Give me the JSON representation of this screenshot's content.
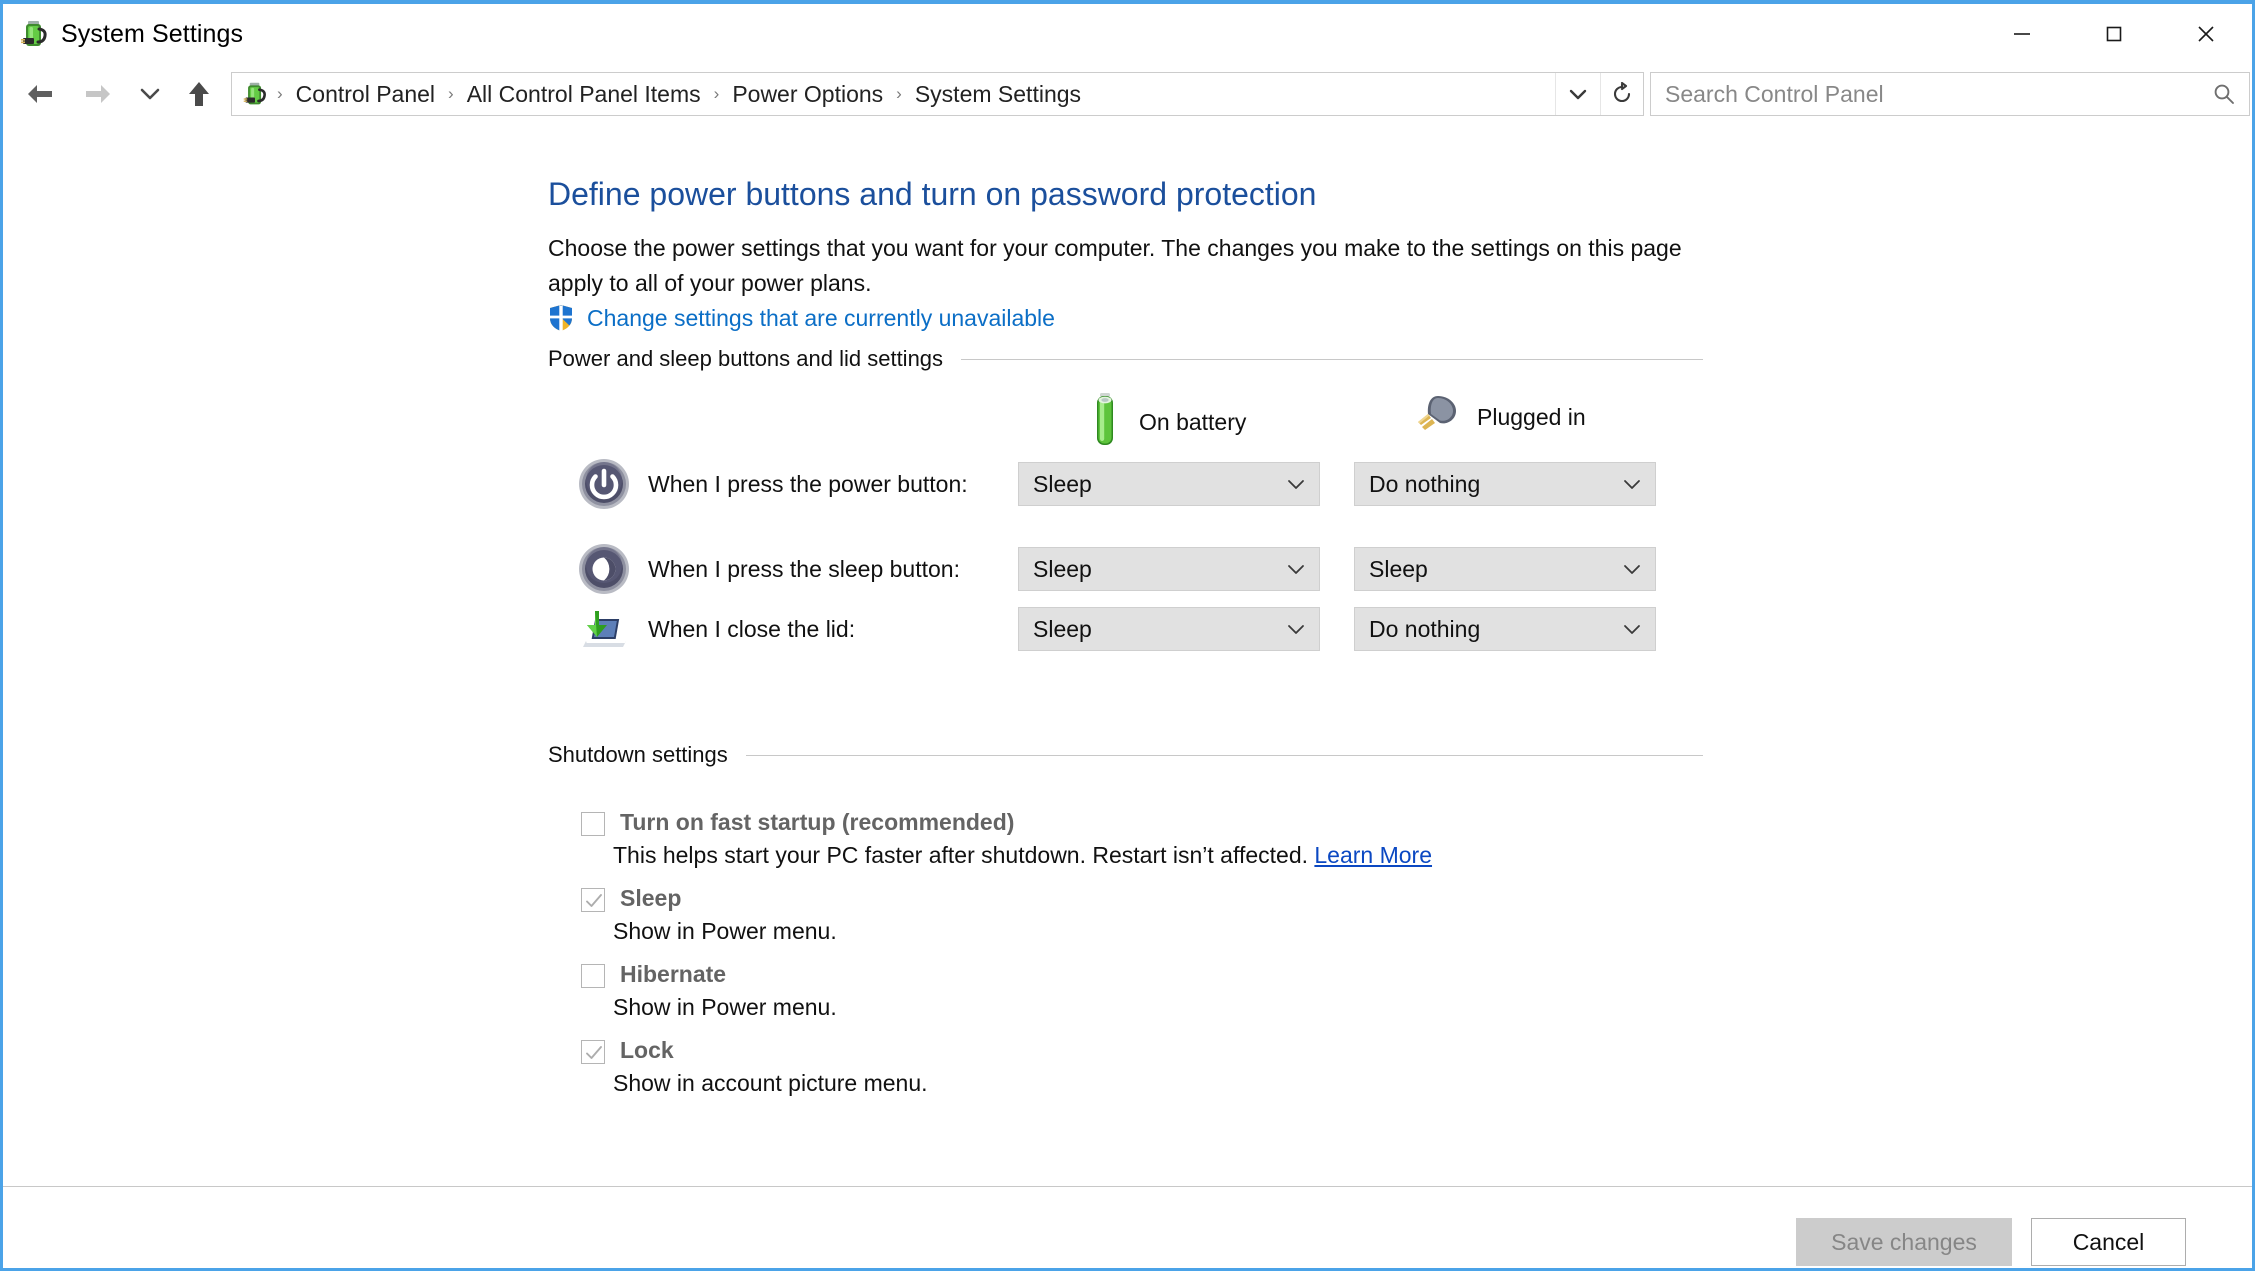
{
  "window": {
    "title": "System Settings",
    "title_icon": "power-battery-icon",
    "minimize_label": "Minimize",
    "maximize_label": "Maximize",
    "close_label": "Close",
    "accent_border": "#4ba3e8"
  },
  "nav": {
    "back_label": "Back",
    "forward_label": "Forward",
    "recent_label": "Recent locations",
    "up_label": "Up one level",
    "breadcrumb_icon": "power-battery-icon",
    "breadcrumbs": [
      "Control Panel",
      "All Control Panel Items",
      "Power Options",
      "System Settings"
    ],
    "separator": "›",
    "previous_locations_label": "Previous locations",
    "refresh_label": "Refresh"
  },
  "search": {
    "placeholder": "Search Control Panel",
    "value": "",
    "icon": "search-icon"
  },
  "page": {
    "heading": "Define power buttons and turn on password protection",
    "description": "Choose the power settings that you want for your computer. The changes you make to the settings on this page apply to all of your power plans.",
    "uac_link": "Change settings that are currently unavailable",
    "uac_icon": "uac-shield-icon",
    "heading_color": "#1b4f9c",
    "link_color": "#0b6ec6"
  },
  "power_section": {
    "title": "Power and sleep buttons and lid settings",
    "columns": [
      {
        "label": "On battery",
        "icon": "battery-icon"
      },
      {
        "label": "Plugged in",
        "icon": "power-plug-icon"
      }
    ],
    "rows": [
      {
        "icon": "power-button-icon",
        "label": "When I press the power button:",
        "on_battery": "Sleep",
        "plugged_in": "Do nothing"
      },
      {
        "icon": "sleep-button-icon",
        "label": "When I press the sleep button:",
        "on_battery": "Sleep",
        "plugged_in": "Sleep"
      },
      {
        "icon": "laptop-lid-icon",
        "label": "When I close the lid:",
        "on_battery": "Sleep",
        "plugged_in": "Do nothing"
      }
    ]
  },
  "shutdown_section": {
    "title": "Shutdown settings",
    "items": [
      {
        "label": "Turn on fast startup (recommended)",
        "checked": false,
        "description": "This helps start your PC faster after shutdown. Restart isn’t affected.",
        "link": "Learn More"
      },
      {
        "label": "Sleep",
        "checked": true,
        "description": "Show in Power menu.",
        "link": ""
      },
      {
        "label": "Hibernate",
        "checked": false,
        "description": "Show in Power menu.",
        "link": ""
      },
      {
        "label": "Lock",
        "checked": true,
        "description": "Show in account picture menu.",
        "link": ""
      }
    ]
  },
  "footer": {
    "save_label": "Save changes",
    "save_enabled": false,
    "cancel_label": "Cancel"
  }
}
